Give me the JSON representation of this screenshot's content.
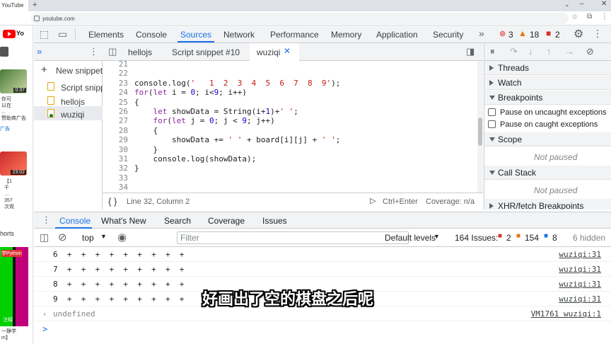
{
  "browser": {
    "tab_title": "YouTube",
    "url": "youtube.com"
  },
  "youtube_strip": {
    "logo_text": "Yo",
    "thumb1_duration": "0:37",
    "thumb1_text": "你可\n以在\n...\n赞助商广告",
    "link_text": "广告",
    "thumb2_duration": "23:02",
    "thumb2_text": "【1\n千\n…\n357\n次观",
    "shorts_label": "horts",
    "thumb3_text": "学Python",
    "thumb3_sub": "注释",
    "bottom_text": "一静学\nm】"
  },
  "devtools": {
    "tabs": [
      "Elements",
      "Console",
      "Sources",
      "Network",
      "Performance",
      "Memory",
      "Application",
      "Security"
    ],
    "active_tab": "Sources",
    "errors": "3",
    "warnings": "18",
    "issues": "2"
  },
  "navigator": {
    "new_snippet": "New snippet",
    "files": [
      "Script snipp",
      "hellojs",
      "wuziqi"
    ],
    "selected": "wuziqi"
  },
  "editor": {
    "tabs": [
      "hellojs",
      "Script snippet #10",
      "wuziqi"
    ],
    "active_tab": "wuziqi",
    "lines": [
      {
        "n": "21",
        "code": ""
      },
      {
        "n": "22",
        "code": ""
      },
      {
        "n": "23",
        "code": "console.log('   1  2  3  4  5  6  7  8  9');"
      },
      {
        "n": "24",
        "code": "for(let i = 0; i<9; i++)"
      },
      {
        "n": "25",
        "code": "{"
      },
      {
        "n": "26",
        "code": "    let showData = String(i+1)+' ';"
      },
      {
        "n": "27",
        "code": "    for(let j = 0; j < 9; j++)"
      },
      {
        "n": "28",
        "code": "    {"
      },
      {
        "n": "29",
        "code": "        showData += ' ' + board[i][j] + ' ';"
      },
      {
        "n": "30",
        "code": "    }"
      },
      {
        "n": "31",
        "code": "    console.log(showData);"
      },
      {
        "n": "32",
        "code": "}"
      },
      {
        "n": "33",
        "code": ""
      },
      {
        "n": "34",
        "code": ""
      }
    ],
    "status_position": "Line 32, Column 2",
    "run_hint": "Ctrl+Enter",
    "coverage": "Coverage: n/a"
  },
  "debugger": {
    "sections": {
      "threads": "Threads",
      "watch": "Watch",
      "breakpoints": "Breakpoints",
      "pause_uncaught": "Pause on uncaught exceptions",
      "pause_caught": "Pause on caught exceptions",
      "scope": "Scope",
      "scope_state": "Not paused",
      "call_stack": "Call Stack",
      "call_stack_state": "Not paused",
      "xhr": "XHR/fetch Breakpoints"
    }
  },
  "drawer": {
    "tabs": [
      "Console",
      "What's New",
      "Search",
      "Coverage",
      "Issues"
    ],
    "active_tab": "Console"
  },
  "console": {
    "context": "top",
    "filter_placeholder": "Filter",
    "levels": "Default levels",
    "issues_label": "164 Issues:",
    "issues_red": "2",
    "issues_yellow": "154",
    "issues_blue": "8",
    "hidden": "6 hidden",
    "rows": [
      {
        "text": "6  +  +  +  +  +  +  +  +  +",
        "source": "wuziqi:31"
      },
      {
        "text": "7  +  +  +  +  +  +  +  +  +",
        "source": "wuziqi:31"
      },
      {
        "text": "8  +  +  +  +  +  +  +  +  +",
        "source": "wuziqi:31"
      },
      {
        "text": "9  +  +  +  +  +  +  +  +  +",
        "source": "wuziqi:31"
      }
    ],
    "result": "undefined",
    "result_source": "VM1761 wuziqi:1",
    "prompt": ">"
  },
  "subtitle": "好画出了空的棋盘之后呢",
  "colors": {
    "accent": "#1a73e8",
    "error": "#d93025",
    "warning": "#e37400"
  }
}
